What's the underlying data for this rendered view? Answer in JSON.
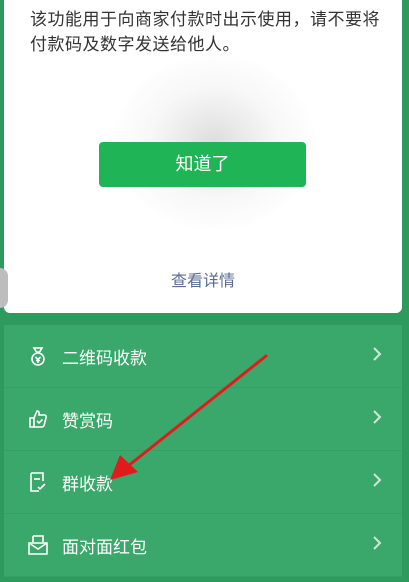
{
  "dialog": {
    "warning_text": "该功能用于向商家付款时出示使用，请不要将付款码及数字发送给他人。",
    "confirm_button": "知道了",
    "details_link": "查看详情"
  },
  "menu": {
    "items": [
      {
        "label": "二维码收款",
        "icon": "money-bag-icon"
      },
      {
        "label": "赞赏码",
        "icon": "thumbs-up-icon"
      },
      {
        "label": "群收款",
        "icon": "group-payment-icon"
      },
      {
        "label": "面对面红包",
        "icon": "red-envelope-icon"
      }
    ]
  },
  "colors": {
    "background": "#2f9a5e",
    "menu_row": "#3aa86a",
    "button": "#1fb556",
    "link": "#586b95",
    "annotation_arrow": "#e11b1b"
  }
}
